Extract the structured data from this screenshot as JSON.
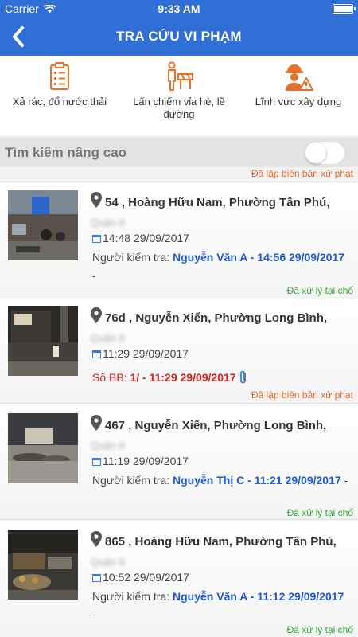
{
  "status_bar": {
    "carrier": "Carrier",
    "time": "9:33 AM"
  },
  "header": {
    "title": "TRA CỨU VI PHẠM"
  },
  "categories": [
    {
      "label": "Xả rác, đổ nước thải",
      "icon": "clipboard-checklist-icon"
    },
    {
      "label": "Lấn chiếm vỉa hè, lề đường",
      "icon": "person-barrier-icon"
    },
    {
      "label": "Lĩnh vực xây dựng",
      "icon": "construction-worker-icon"
    }
  ],
  "advanced_search": {
    "label": "Tìm kiếm nâng cao",
    "enabled": false,
    "note": "Đã lập biên bản xử phạt"
  },
  "cards": [
    {
      "address": "54 , Hoàng Hữu Nam, Phường Tân Phú,",
      "district": "Quận 9",
      "time": "14:48 29/09/2017",
      "inspector_label": "Người kiểm tra: ",
      "inspector_value": "Nguyễn Văn A - 14:56 29/09/2017",
      "suffix": " -",
      "status": "Đã xử lý tại chổ"
    },
    {
      "address": "76d , Nguyễn Xiển, Phường Long Bình,",
      "district": "Quận 9",
      "time": "11:29 29/09/2017",
      "record_label": "Số BB: ",
      "record_value": "1/ - 11:29 29/09/2017",
      "status": "Đã lập biên bản xử phạt"
    },
    {
      "address": "467 , Nguyễn Xiển, Phường Long Bình,",
      "district": "Quận 9",
      "time": "11:19 29/09/2017",
      "inspector_label": "Người kiểm tra: ",
      "inspector_value": "Nguyễn Thị C - 11:21 29/09/2017",
      "suffix": " -",
      "status": "Đã xử lý tại chổ"
    },
    {
      "address": "865 , Hoàng Hữu Nam, Phường Tân Phú,",
      "district": "Quận 9",
      "time": "10:52 29/09/2017",
      "inspector_label": "Người kiểm tra: ",
      "inspector_value": "Nguyễn Văn A - 11:12 29/09/2017",
      "suffix": " -",
      "status": "Đã xử lý tại chổ"
    }
  ],
  "colors": {
    "primary": "#2f6fd6",
    "accent_orange": "#e86a2a",
    "success_green": "#2fae2f",
    "link_blue": "#1f5ad6",
    "alert_red": "#d6221a"
  }
}
